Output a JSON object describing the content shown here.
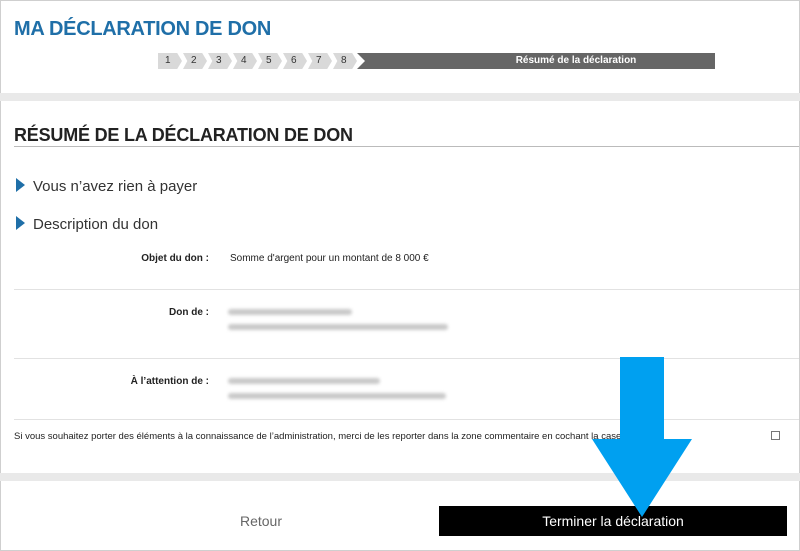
{
  "header": {
    "title": "MA DÉCLARATION DE DON",
    "steps": [
      "1",
      "2",
      "3",
      "4",
      "5",
      "6",
      "7",
      "8"
    ],
    "current_step_label": "Résumé de la déclaration"
  },
  "summary": {
    "title": "RÉSUMÉ DE LA DÉCLARATION DE DON",
    "payment_heading": "Vous n’avez rien à payer",
    "description_heading": "Description du don",
    "rows": [
      {
        "label": "Objet du don :",
        "value": "Somme d'argent pour un montant de 8 000 €"
      },
      {
        "label": "Don de :",
        "value": ""
      },
      {
        "label": "À l’attention de :",
        "value": ""
      }
    ],
    "notice": "Si vous souhaitez porter des éléments à la connaissance de l’administration, merci de les reporter dans la zone commentaire en cochant la case ci-après"
  },
  "footer": {
    "back_label": "Retour",
    "finish_label": "Terminer la déclaration"
  },
  "colors": {
    "accent": "#1f6fa8",
    "annotation_arrow": "#00a0f0",
    "finish_button": "#000000"
  },
  "icons": {
    "section_bullet": "triangle-right-icon",
    "annotation": "arrow-down-icon"
  }
}
